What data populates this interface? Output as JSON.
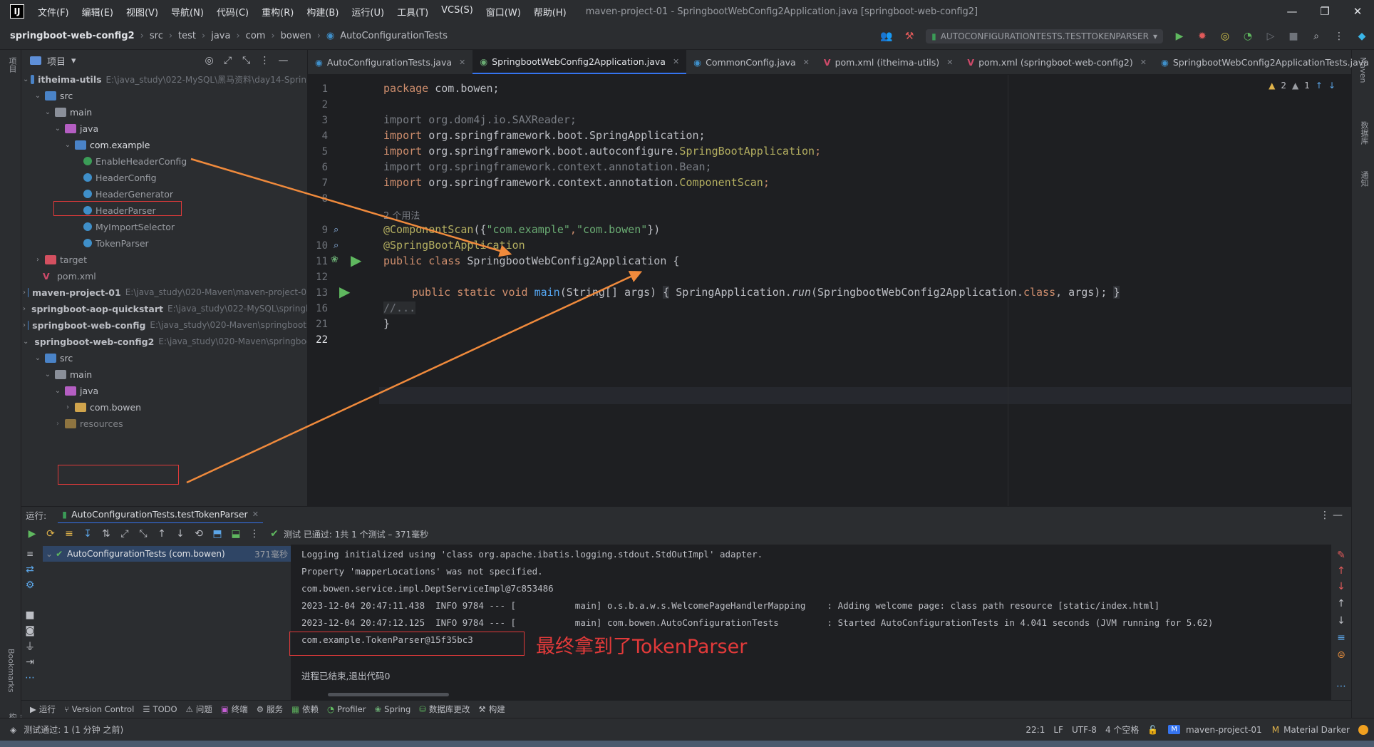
{
  "menu": [
    "文件(F)",
    "编辑(E)",
    "视图(V)",
    "导航(N)",
    "代码(C)",
    "重构(R)",
    "构建(B)",
    "运行(U)",
    "工具(T)",
    "VCS(S)",
    "窗口(W)",
    "帮助(H)"
  ],
  "window_title": "maven-project-01 - SpringbootWebConfig2Application.java [springboot-web-config2]",
  "breadcrumb": [
    "springboot-web-config2",
    "src",
    "test",
    "java",
    "com",
    "bowen",
    "AutoConfigurationTests"
  ],
  "run_config": "AUTOCONFIGURATIONTESTS.TESTTOKENPARSER",
  "project_panel": {
    "title": "项目"
  },
  "tree": [
    {
      "label": "itheima-utils",
      "path": "E:\\java_study\\022-MySQL\\黑马资料\\day14-Sprin"
    },
    {
      "label": "src"
    },
    {
      "label": "main"
    },
    {
      "label": "java"
    },
    {
      "label": "com.example"
    },
    {
      "label": "EnableHeaderConfig"
    },
    {
      "label": "HeaderConfig"
    },
    {
      "label": "HeaderGenerator"
    },
    {
      "label": "HeaderParser"
    },
    {
      "label": "MyImportSelector"
    },
    {
      "label": "TokenParser"
    },
    {
      "label": "target"
    },
    {
      "label": "pom.xml"
    },
    {
      "label": "maven-project-01",
      "path": "E:\\java_study\\020-Maven\\maven-project-0"
    },
    {
      "label": "springboot-aop-quickstart",
      "path": "E:\\java_study\\022-MySQL\\springb"
    },
    {
      "label": "springboot-web-config",
      "path": "E:\\java_study\\020-Maven\\springboot"
    },
    {
      "label": "springboot-web-config2",
      "path": "E:\\java_study\\020-Maven\\springboo"
    },
    {
      "label": "src"
    },
    {
      "label": "main"
    },
    {
      "label": "java"
    },
    {
      "label": "com.bowen"
    },
    {
      "label": "resources"
    }
  ],
  "tabs": [
    {
      "label": "AutoConfigurationTests.java"
    },
    {
      "label": "SpringbootWebConfig2Application.java"
    },
    {
      "label": "CommonConfig.java"
    },
    {
      "label": "pom.xml (itheima-utils)"
    },
    {
      "label": "pom.xml (springboot-web-config2)"
    },
    {
      "label": "SpringbootWebConfig2ApplicationTests.java"
    }
  ],
  "editor": {
    "line_numbers": [
      "1",
      "2",
      "3",
      "4",
      "5",
      "6",
      "7",
      "8",
      "9",
      "10",
      "11",
      "12",
      "13",
      "16",
      "21",
      "22"
    ],
    "line1": {
      "kw": "package",
      "rest": " com.bowen;"
    },
    "line3": "import org.dom4j.io.SAXReader;",
    "line4": {
      "kw": "import",
      "rest": " org.springframework.boot.SpringApplication;"
    },
    "line5": {
      "kw": "import",
      "rest": " org.springframework.boot.autoconfigure.",
      "ann": "SpringBootApplication",
      ";": ";"
    },
    "line6": "import org.springframework.context.annotation.Bean;",
    "line7": {
      "kw": "import",
      "rest": " org.springframework.context.annotation.",
      "ann": "ComponentScan",
      ";": ";"
    },
    "usage_hint": "2 个用法",
    "line9": {
      "ann": "@ComponentScan",
      "p1": "({",
      "s1": "\"com.example\"",
      "c": ",",
      "s2": "\"com.bowen\"",
      "p2": "})"
    },
    "line10": "@SpringBootApplication",
    "line11": {
      "kw": "public class ",
      "name": "SpringbootWebConfig2Application {"
    },
    "line13": {
      "kw": "public static void ",
      "fn": "main",
      "a": "(String[] args) ",
      "b": "{",
      "c": " SpringApplication.",
      "run": "run",
      "d": "(SpringbootWebConfig2Application.",
      "cls": "class",
      ",": ", args); ",
      "e": "}"
    },
    "line16": "//...",
    "line21": "}",
    "warnings": {
      "warn": "2",
      "weak": "1"
    }
  },
  "run_panel": {
    "label": "运行:",
    "tab": "AutoConfigurationTests.testTokenParser",
    "status": "测试 已通过: 1共 1 个测试 – 371毫秒",
    "test_node": "AutoConfigurationTests (com.bowen)",
    "test_time": "371毫秒"
  },
  "console": [
    "Logging initialized using 'class org.apache.ibatis.logging.stdout.StdOutImpl' adapter.",
    "Property 'mapperLocations' was not specified.",
    "com.bowen.service.impl.DeptServiceImpl@7c853486",
    "2023-12-04 20:47:11.438  INFO 9784 --- [           main] o.s.b.a.w.s.WelcomePageHandlerMapping    : Adding welcome page: class path resource [static/index.html]",
    "2023-12-04 20:47:12.125  INFO 9784 --- [           main] com.bowen.AutoConfigurationTests         : Started AutoConfigurationTests in 4.041 seconds (JVM running for 5.62)",
    "com.example.TokenParser@15f35bc3",
    "进程已结束,退出代码0"
  ],
  "annotation_text": "最终拿到了TokenParser",
  "bottom_tools": [
    "运行",
    "Version Control",
    "TODO",
    "问题",
    "终端",
    "服务",
    "依赖",
    "Profiler",
    "Spring",
    "数据库更改",
    "构建"
  ],
  "statusbar": {
    "left": "测试通过: 1 (1 分钟 之前)",
    "pos": "22:1",
    "lf": "LF",
    "enc": "UTF-8",
    "indent": "4 个空格",
    "project": "maven-project-01",
    "theme": "Material Darker"
  },
  "left_stripe": {
    "top": "项目",
    "bookmarks": "Bookmarks",
    "structure": "结构"
  },
  "right_stripe": [
    "Maven",
    "数据库",
    "通知"
  ],
  "colors": {
    "accent": "#3574f0",
    "arrow": "#f08a3c",
    "redbox": "#e03a3a"
  }
}
